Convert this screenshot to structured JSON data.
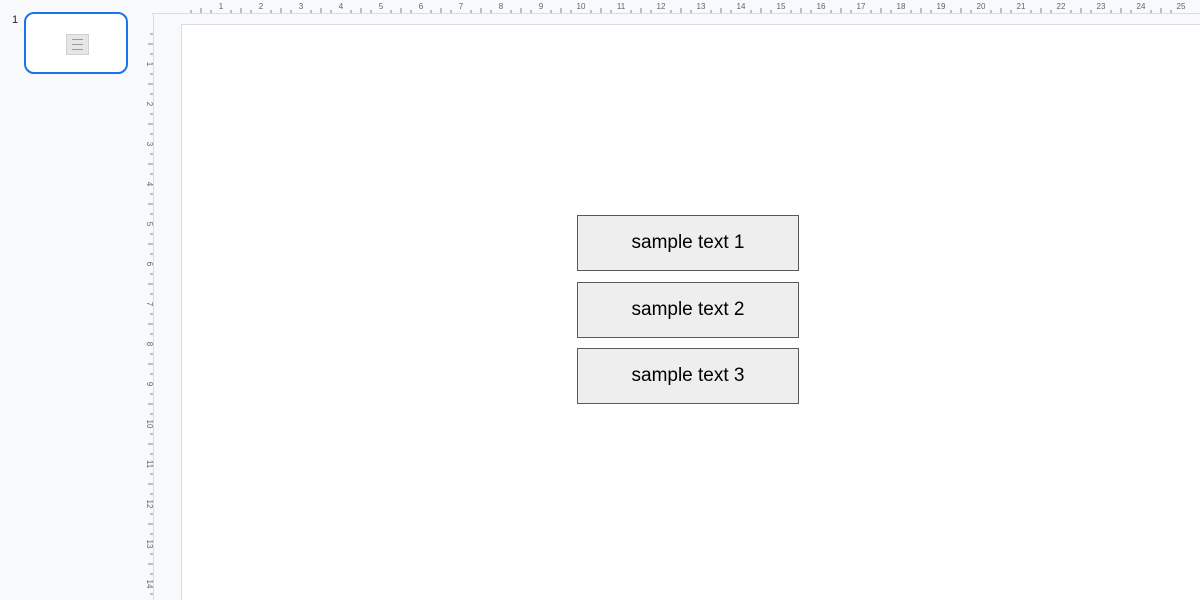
{
  "filmstrip": {
    "slides": [
      {
        "number": "1"
      }
    ]
  },
  "ruler": {
    "horizontal_labels": [
      "1",
      "2",
      "3",
      "4",
      "5",
      "6",
      "7",
      "8",
      "9",
      "10",
      "11",
      "12",
      "13",
      "14",
      "15",
      "16",
      "17",
      "18",
      "19",
      "20",
      "21",
      "22",
      "23",
      "24",
      "25"
    ],
    "vertical_labels": [
      "1",
      "2",
      "3",
      "4",
      "5",
      "6",
      "7",
      "8",
      "9",
      "10",
      "11",
      "12",
      "13",
      "14"
    ]
  },
  "slide": {
    "text_boxes": [
      {
        "text": "sample text 1"
      },
      {
        "text": "sample text 2"
      },
      {
        "text": "sample text 3"
      }
    ]
  },
  "colors": {
    "selection_accent": "#1a73e8",
    "box_fill": "#eeeeee",
    "box_border": "#595959"
  }
}
